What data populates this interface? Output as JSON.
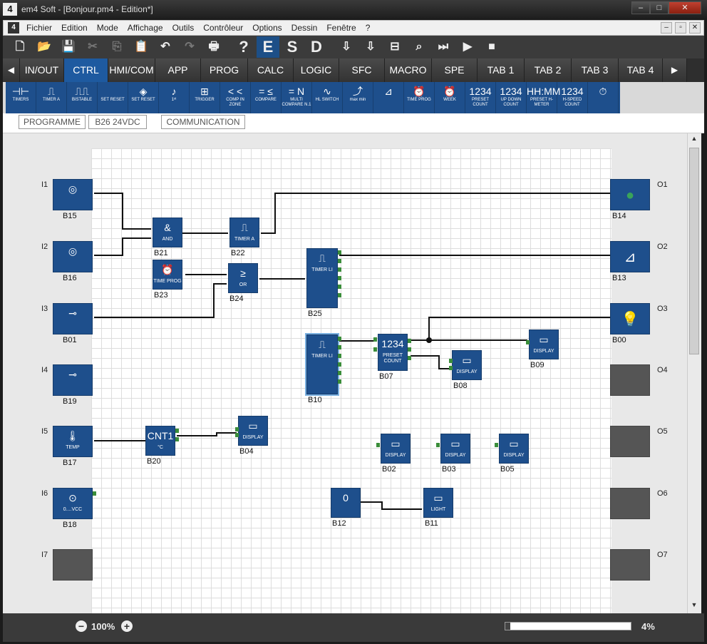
{
  "window": {
    "title": "em4 Soft - [Bonjour.pm4 - Edition*]",
    "logo": "4",
    "controls": [
      "–",
      "□",
      "✕"
    ]
  },
  "menu": {
    "items": [
      "Fichier",
      "Edition",
      "Mode",
      "Affichage",
      "Outils",
      "Contrôleur",
      "Options",
      "Dessin",
      "Fenêtre",
      "?"
    ],
    "controls": [
      "–",
      "▫",
      "✕"
    ]
  },
  "toolbar": {
    "items": [
      {
        "icon": "new-file-icon",
        "glyph": "🗋"
      },
      {
        "icon": "open-folder-icon",
        "glyph": "📂"
      },
      {
        "icon": "save-icon",
        "glyph": "💾"
      },
      {
        "icon": "cut-icon",
        "glyph": "✂"
      },
      {
        "icon": "copy-icon",
        "glyph": "⎘"
      },
      {
        "icon": "paste-icon",
        "glyph": "📋"
      },
      {
        "icon": "undo-icon",
        "glyph": "↶"
      },
      {
        "icon": "redo-icon",
        "glyph": "↷"
      },
      {
        "icon": "print-icon",
        "glyph": "🖶"
      },
      {
        "icon": "help-icon",
        "glyph": "?"
      },
      {
        "icon": "edit-mode-icon",
        "glyph": "E"
      },
      {
        "icon": "simulation-mode-icon",
        "glyph": "S"
      },
      {
        "icon": "debug-mode-icon",
        "glyph": "D"
      },
      {
        "icon": "compile-icon",
        "glyph": "⇩"
      },
      {
        "icon": "transfer-icon",
        "glyph": "⇩"
      },
      {
        "icon": "connect-icon",
        "glyph": "⊟"
      },
      {
        "icon": "search-controller-icon",
        "glyph": "⌕"
      },
      {
        "icon": "step-icon",
        "glyph": "⏭"
      },
      {
        "icon": "run-icon",
        "glyph": "▶"
      },
      {
        "icon": "stop-icon",
        "glyph": "■"
      }
    ]
  },
  "tabs": [
    "IN/OUT",
    "CTRL",
    "HMI/COM",
    "APP",
    "PROG",
    "CALC",
    "LOGIC",
    "SFC",
    "MACRO",
    "SPE",
    "TAB 1",
    "TAB 2",
    "TAB 3",
    "TAB 4"
  ],
  "ribbon": [
    {
      "glyph": "⊣⊢",
      "label": "TIMERS"
    },
    {
      "glyph": "⎍",
      "label": "TIMER A"
    },
    {
      "glyph": "⎍⎍",
      "label": "BISTABLE"
    },
    {
      "glyph": "",
      "label": "SET RESET"
    },
    {
      "glyph": "◈",
      "label": "SET RESET"
    },
    {
      "glyph": "♪",
      "label": "1ˢᵗ"
    },
    {
      "glyph": "⊞",
      "label": "TRIGGER"
    },
    {
      "glyph": "< <",
      "label": "COMP IN ZONE"
    },
    {
      "glyph": "= ≤",
      "label": "COMPARE"
    },
    {
      "glyph": "= N",
      "label": "MULTI COMPARE N.1"
    },
    {
      "glyph": "∿",
      "label": "HL SWITCH"
    },
    {
      "glyph": "⤴",
      "label": "max min"
    },
    {
      "glyph": "⊿",
      "label": ""
    },
    {
      "glyph": "⏰",
      "label": "TIME PROG"
    },
    {
      "glyph": "⏰",
      "label": "WEEK"
    },
    {
      "glyph": "1234",
      "label": "PRESET COUNT"
    },
    {
      "glyph": "1234",
      "label": "UP DOWN COUNT"
    },
    {
      "glyph": "HH:MM",
      "label": "PRESET H-METER"
    },
    {
      "glyph": "1234",
      "label": "H-SPEED COUNT"
    },
    {
      "glyph": "⏱",
      "label": ""
    }
  ],
  "subbar": {
    "programme": "PROGRAMME",
    "device": "B26 24VDC",
    "communication": "COMMUNICATION"
  },
  "inputs": [
    {
      "pin": "I1",
      "id": "B15",
      "glyph": "◎",
      "text": ""
    },
    {
      "pin": "I2",
      "id": "B16",
      "glyph": "◎",
      "text": ""
    },
    {
      "pin": "I3",
      "id": "B01",
      "glyph": "⊸",
      "text": ""
    },
    {
      "pin": "I4",
      "id": "B19",
      "glyph": "⊸",
      "text": ""
    },
    {
      "pin": "I5",
      "id": "B17",
      "glyph": "🌡",
      "text": "TEMP"
    },
    {
      "pin": "I6",
      "id": "B18",
      "glyph": "⊙",
      "text": "0....VCC"
    },
    {
      "pin": "I7",
      "id": "",
      "glyph": "",
      "text": ""
    }
  ],
  "outputs": [
    {
      "pin": "O1",
      "id": "B14",
      "glyph": "●"
    },
    {
      "pin": "O2",
      "id": "B13",
      "glyph": "⊿"
    },
    {
      "pin": "O3",
      "id": "B00",
      "glyph": "💡"
    },
    {
      "pin": "O4",
      "id": "",
      "glyph": ""
    },
    {
      "pin": "O5",
      "id": "",
      "glyph": ""
    },
    {
      "pin": "O6",
      "id": "",
      "glyph": ""
    },
    {
      "pin": "O7",
      "id": "",
      "glyph": ""
    }
  ],
  "blocks": [
    {
      "id": "B21",
      "glyph": "&",
      "text": "AND"
    },
    {
      "id": "B22",
      "glyph": "⎍",
      "text": "TIMER A"
    },
    {
      "id": "B23",
      "glyph": "⏰",
      "text": "TIME PROG"
    },
    {
      "id": "B24",
      "glyph": "≥",
      "text": "OR"
    },
    {
      "id": "B25",
      "glyph": "⎍",
      "text": "TIMER LI"
    },
    {
      "id": "B10",
      "glyph": "⎍",
      "text": "TIMER LI"
    },
    {
      "id": "B07",
      "glyph": "1234",
      "text": "PRESET COUNT"
    },
    {
      "id": "B08",
      "glyph": "▭",
      "text": "DISPLAY"
    },
    {
      "id": "B09",
      "glyph": "▭",
      "text": "DISPLAY"
    },
    {
      "id": "B20",
      "glyph": "CNT1",
      "text": "°C"
    },
    {
      "id": "B04",
      "glyph": "▭",
      "text": "DISPLAY"
    },
    {
      "id": "B02",
      "glyph": "▭",
      "text": "DISPLAY"
    },
    {
      "id": "B03",
      "glyph": "▭",
      "text": "DISPLAY"
    },
    {
      "id": "B05",
      "glyph": "▭",
      "text": "DISPLAY"
    },
    {
      "id": "B12",
      "glyph": "0",
      "text": ""
    },
    {
      "id": "B11",
      "glyph": "▭",
      "text": "LIGHT"
    }
  ],
  "status": {
    "zoom": "100%",
    "progress_text": "4%",
    "progress_value": 0.04
  },
  "colors": {
    "block": "#1e4f8c",
    "tab_active": "#1e5aa0",
    "output_on": "#3aa35a"
  }
}
